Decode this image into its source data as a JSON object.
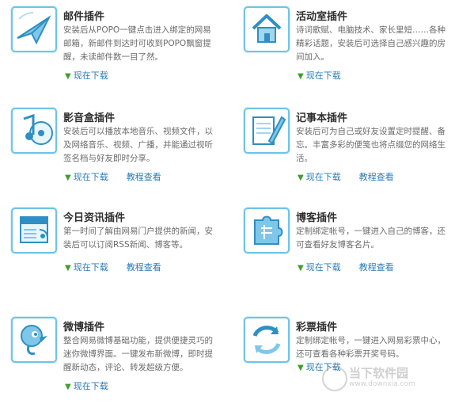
{
  "plugins": [
    {
      "title": "邮件插件",
      "desc": "安装后从POPO一键点击进入绑定的网易邮箱，新邮件到达时可收到POPO飘窗提醒，未读邮件数一目了然。",
      "icon": "mail-plane-icon",
      "links": {
        "download": "现在下载"
      }
    },
    {
      "title": "活动室插件",
      "desc": "诗词歌赋、电脑技术、家长里短……各种精彩话题，安装后可选择自己感兴趣的房间加入。",
      "icon": "house-icon",
      "links": {
        "download": "现在下载"
      }
    },
    {
      "title": "影音盒插件",
      "desc": "安装后可以播放本地音乐、视频文件，以及网络音乐、视频、广播，并能通过视听签名档与好友即时分享。",
      "icon": "music-disc-icon",
      "links": {
        "download": "现在下载",
        "tutorial": "教程查看"
      }
    },
    {
      "title": "记事本插件",
      "desc": "安装后可为自己或好友设置定时提醒、备忘。丰富多彩的便笺也将点缀您的网络生活。",
      "icon": "notepad-pen-icon",
      "links": {
        "download": "现在下载",
        "tutorial": "教程查看"
      }
    },
    {
      "title": "今日资讯插件",
      "desc": "第一时间了解由网易门户提供的新闻，安装后可以订阅RSS新闻、博客等。",
      "icon": "news-rss-icon",
      "links": {
        "download": "现在下载",
        "tutorial": "教程查看"
      }
    },
    {
      "title": "博客插件",
      "desc": "定制绑定帐号，一键进入自己的博客，还可查看好友博客名片。",
      "icon": "blog-puzzle-icon",
      "links": {
        "download": "现在下载",
        "tutorial": "教程查看"
      }
    },
    {
      "title": "微博插件",
      "desc": "整合网易微博基础功能，提供便捷灵巧的迷你微博界面。一键发布新微博，即时提醒新动态，评论、转发超级方便。",
      "icon": "weibo-bird-icon",
      "links": {
        "download": "现在下载"
      }
    },
    {
      "title": "彩票插件",
      "desc": "定制绑定帐号，一键进入网易彩票中心，还可查看各种彩票开奖号码。",
      "icon": "lottery-arrows-icon",
      "links": {
        "download": "现在下载"
      }
    }
  ],
  "watermark": {
    "text": "当下软件园",
    "sub": "www.downxia.com"
  },
  "colors": {
    "accent": "#2a7bb8",
    "icon_border": "#6ec4e6",
    "chevron": "#3f9e2c"
  }
}
